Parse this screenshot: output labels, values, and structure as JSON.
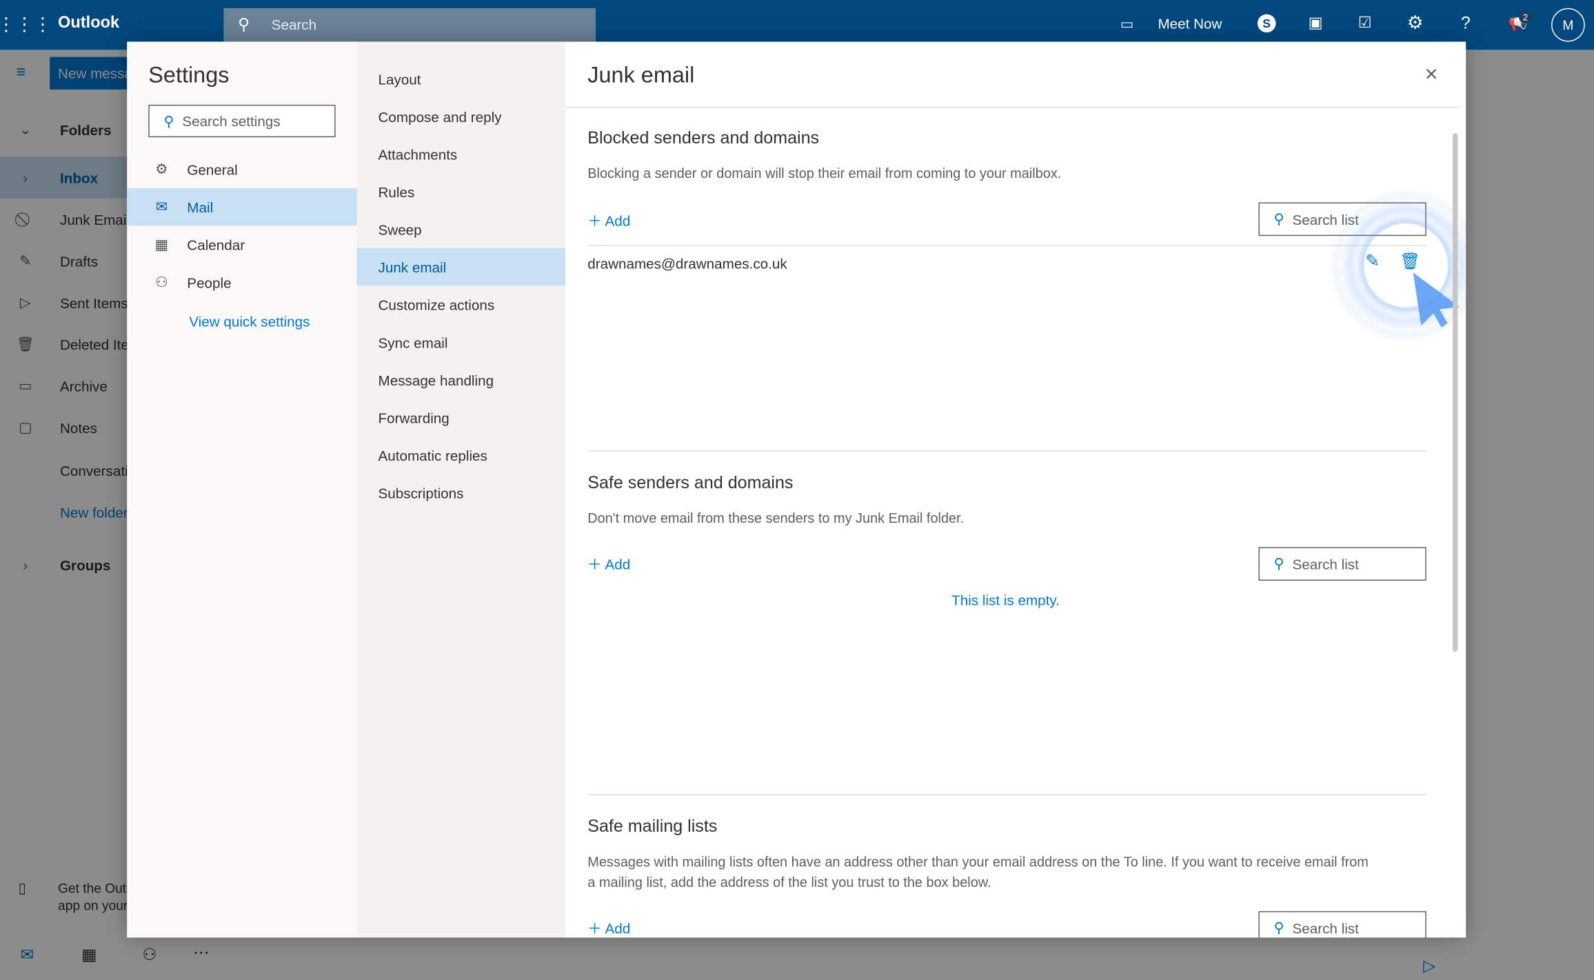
{
  "topbar": {
    "app_name": "Outlook",
    "search_placeholder": "Search",
    "meet_now": "Meet Now",
    "notification_count": "2",
    "avatar_initial": "M",
    "icons": [
      "app-launcher-icon",
      "search-icon",
      "video-icon",
      "skype-icon",
      "office-icon",
      "todo-icon",
      "gear-icon",
      "help-icon",
      "megaphone-icon"
    ]
  },
  "background_app": {
    "new_message": "New message",
    "folders_label": "Folders",
    "folders": [
      {
        "label": "Inbox",
        "icon": "chevron-right-icon"
      },
      {
        "label": "Junk Email",
        "icon": "block-icon"
      },
      {
        "label": "Drafts",
        "icon": "pencil-icon"
      },
      {
        "label": "Sent Items",
        "icon": "send-icon"
      },
      {
        "label": "Deleted Items",
        "icon": "trash-icon"
      },
      {
        "label": "Archive",
        "icon": "archive-icon"
      },
      {
        "label": "Notes",
        "icon": "note-icon"
      },
      {
        "label": "Conversation History",
        "icon": ""
      },
      {
        "label": "New folder",
        "icon": ""
      }
    ],
    "groups_label": "Groups",
    "get_app_line1": "Get the Outlook",
    "get_app_line2": "app on your phone"
  },
  "settings": {
    "title": "Settings",
    "search_placeholder": "Search settings",
    "categories": [
      {
        "label": "General",
        "icon": "gear-icon"
      },
      {
        "label": "Mail",
        "icon": "mail-icon",
        "selected": true
      },
      {
        "label": "Calendar",
        "icon": "calendar-icon"
      },
      {
        "label": "People",
        "icon": "people-icon"
      }
    ],
    "view_quick_settings": "View quick settings",
    "mail_sections": [
      "Layout",
      "Compose and reply",
      "Attachments",
      "Rules",
      "Sweep",
      "Junk email",
      "Customize actions",
      "Sync email",
      "Message handling",
      "Forwarding",
      "Automatic replies",
      "Subscriptions"
    ],
    "selected_section": "Junk email"
  },
  "junk": {
    "title": "Junk email",
    "blocked": {
      "heading": "Blocked senders and domains",
      "description": "Blocking a sender or domain will stop their email from coming to your mailbox.",
      "add": "Add",
      "search": "Search list",
      "entries": [
        "drawnames@drawnames.co.uk"
      ]
    },
    "safe": {
      "heading": "Safe senders and domains",
      "description": "Don't move email from these senders to my Junk Email folder.",
      "add": "Add",
      "search": "Search list",
      "empty": "This list is empty."
    },
    "mailing": {
      "heading": "Safe mailing lists",
      "description_1": "Messages with mailing lists often have an address other than your email address on the To line. If you want to receive email from",
      "description_2": "a mailing list, add the address of the list you trust to the box below.",
      "add": "Add",
      "search": "Search list"
    }
  },
  "colors": {
    "topbar": "#02487f",
    "accent": "#0078d4",
    "selected": "#c7e0f4",
    "cursor": "#5c9cf5"
  }
}
